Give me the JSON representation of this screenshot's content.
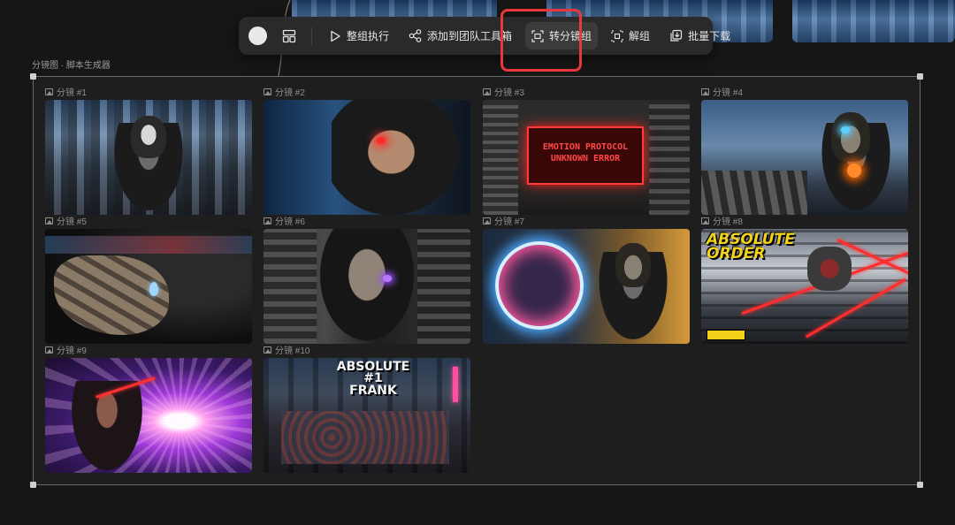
{
  "toolbar": {
    "buttons": [
      {
        "label": "整组执行",
        "icon": "play-icon"
      },
      {
        "label": "添加到团队工具箱",
        "icon": "share-nodes-icon"
      },
      {
        "label": "转分镜组",
        "icon": "scan-frame-icon",
        "active": true
      },
      {
        "label": "解组",
        "icon": "ungroup-icon"
      },
      {
        "label": "批量下载",
        "icon": "batch-download-icon"
      }
    ]
  },
  "group": {
    "label": "分镜图 · 脚本生成器",
    "shots": [
      {
        "label": "分镜 #1"
      },
      {
        "label": "分镜 #2"
      },
      {
        "label": "分镜 #3",
        "text": "EMOTION PROTOCOL\nUNKNOWN ERROR"
      },
      {
        "label": "分镜 #4"
      },
      {
        "label": "分镜 #5"
      },
      {
        "label": "分镜 #6"
      },
      {
        "label": "分镜 #7"
      },
      {
        "label": "分镜 #8",
        "text": "ABSOLUTE\nORDER"
      },
      {
        "label": "分镜 #9"
      },
      {
        "label": "分镜 #10",
        "text": "ABSOLUTE #1\nFRANK"
      }
    ]
  },
  "colors": {
    "highlight": "#e8383d",
    "background": "#161616",
    "toolbar": "#2a2a2a"
  }
}
